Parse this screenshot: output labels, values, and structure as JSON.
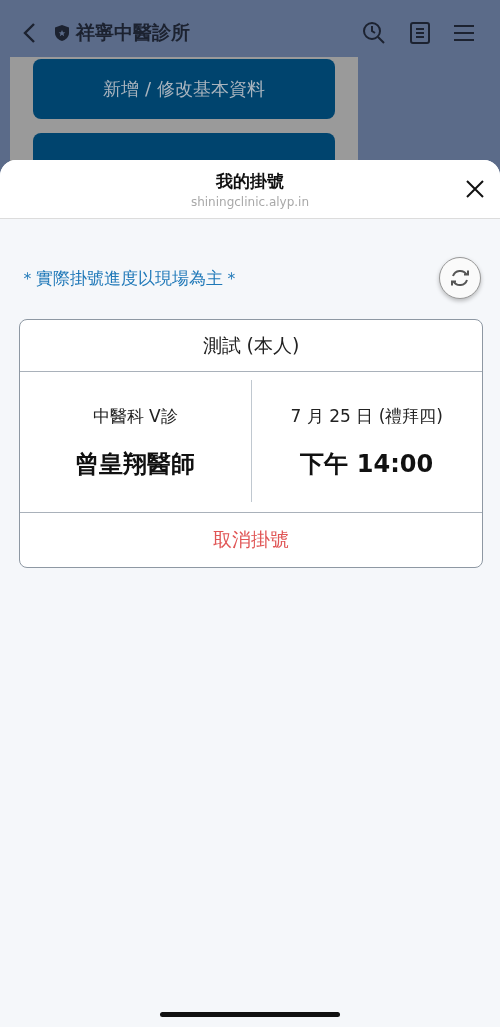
{
  "background_page": {
    "nav_title": "祥寧中醫診所",
    "buttons": [
      "新增 / 修改基本資料"
    ]
  },
  "sheet": {
    "title": "我的掛號",
    "domain": "shiningclinic.alyp.in",
    "notice": "＊實際掛號進度以現場為主＊",
    "appointment": {
      "patient": "測試 (本人)",
      "department": "中醫科 V診",
      "doctor": "曾皇翔醫師",
      "date": "7 月 25 日 (禮拜四)",
      "time": "下午 14:00",
      "cancel_label": "取消掛號"
    }
  }
}
